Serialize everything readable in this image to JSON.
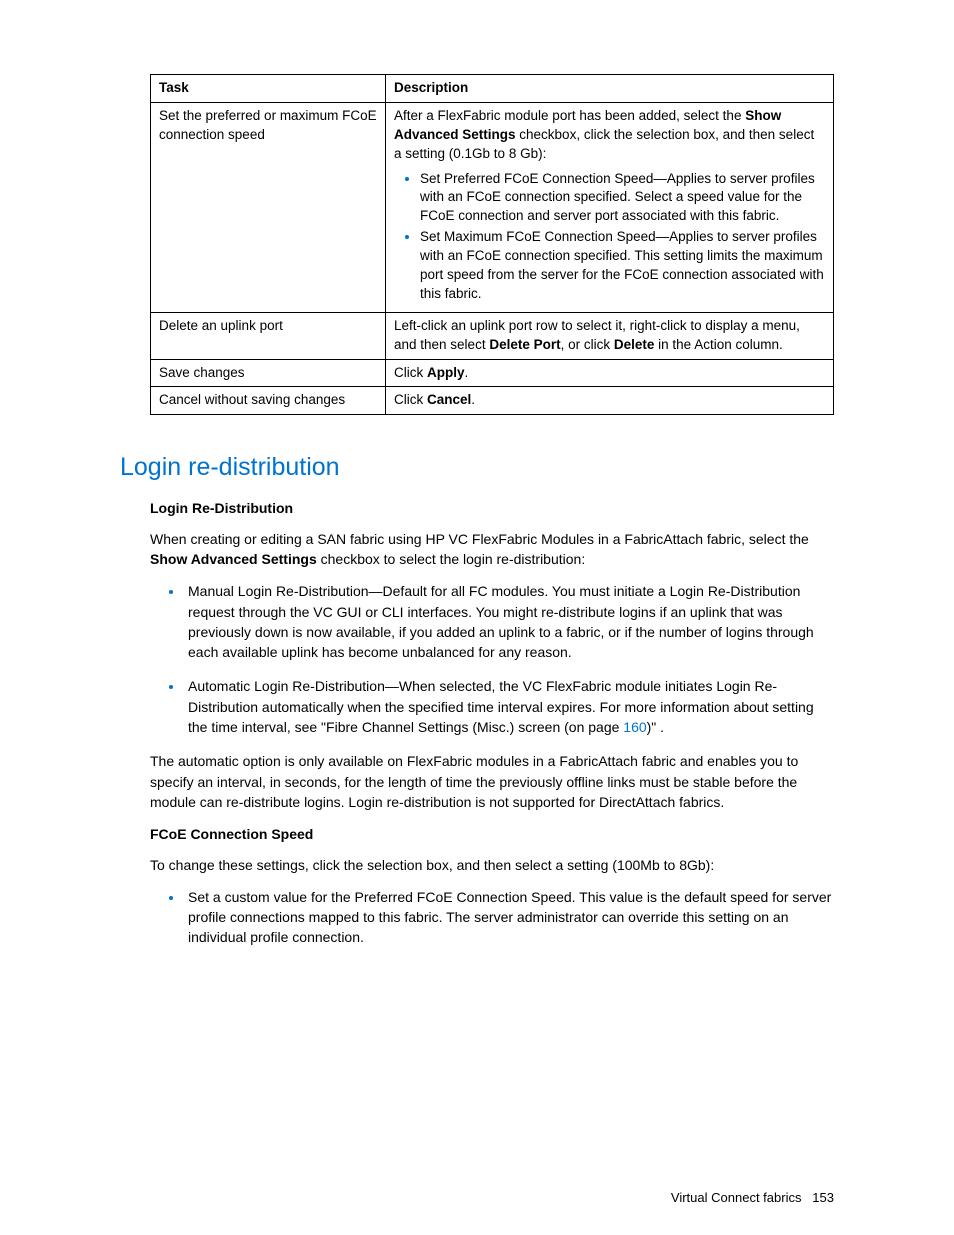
{
  "table": {
    "headers": {
      "task": "Task",
      "description": "Description"
    },
    "rows": [
      {
        "task": "Set the preferred or maximum FCoE connection speed",
        "desc_pre": "After a FlexFabric module port has been added, select the ",
        "desc_bold1": "Show Advanced Settings",
        "desc_post": " checkbox, click the selection box, and then select a setting (0.1Gb to 8 Gb):",
        "bullets": [
          "Set Preferred FCoE Connection Speed—Applies to server profiles with an FCoE connection specified. Select a speed value for the FCoE connection and server port associated with this fabric.",
          "Set Maximum FCoE Connection Speed—Applies to server profiles with an FCoE connection specified. This setting limits the maximum port speed from the server for the FCoE connection associated with this fabric."
        ]
      },
      {
        "task": "Delete an uplink port",
        "desc_pre": "Left-click an uplink port row to select it, right-click to display a menu, and then select ",
        "desc_bold1": "Delete Port",
        "desc_mid": ", or click ",
        "desc_bold2": "Delete",
        "desc_post": " in the Action column."
      },
      {
        "task": "Save changes",
        "desc_pre": "Click ",
        "desc_bold1": "Apply",
        "desc_post": "."
      },
      {
        "task": "Cancel without saving changes",
        "desc_pre": "Click ",
        "desc_bold1": "Cancel",
        "desc_post": "."
      }
    ]
  },
  "section": {
    "heading": "Login re-distribution",
    "sub1": "Login Re-Distribution",
    "p1_pre": "When creating or editing a SAN fabric using HP VC FlexFabric Modules in a FabricAttach fabric, select the ",
    "p1_bold": "Show Advanced Settings",
    "p1_post": " checkbox to select the login re-distribution:",
    "bullets": [
      {
        "text": "Manual Login Re-Distribution—Default for all FC modules. You must initiate a Login Re-Distribution request through the VC GUI or CLI interfaces. You might re-distribute logins if an uplink that was previously down is now available, if you added an uplink to a fabric, or if the number of logins through each available uplink has become unbalanced for any reason."
      },
      {
        "pre": "Automatic Login Re-Distribution—When selected, the VC FlexFabric module initiates Login Re-Distribution automatically when the specified time interval expires. For more information about setting the time interval, see \"Fibre Channel Settings (Misc.) screen (on page ",
        "link": "160",
        "post": ")\" ."
      }
    ],
    "p2": "The automatic option is only available on FlexFabric modules in a FabricAttach fabric and enables you to specify an interval, in seconds, for the length of time the previously offline links must be stable before the module can re-distribute logins. Login re-distribution is not supported for DirectAttach fabrics.",
    "sub2": "FCoE Connection Speed",
    "p3": "To change these settings, click the selection box, and then select a setting (100Mb to 8Gb):",
    "bullets2": [
      "Set a custom value for the Preferred FCoE Connection Speed. This value is the default speed for server profile connections mapped to this fabric. The server administrator can override this setting on an individual profile connection."
    ]
  },
  "footer": {
    "section": "Virtual Connect fabrics",
    "page": "153"
  }
}
